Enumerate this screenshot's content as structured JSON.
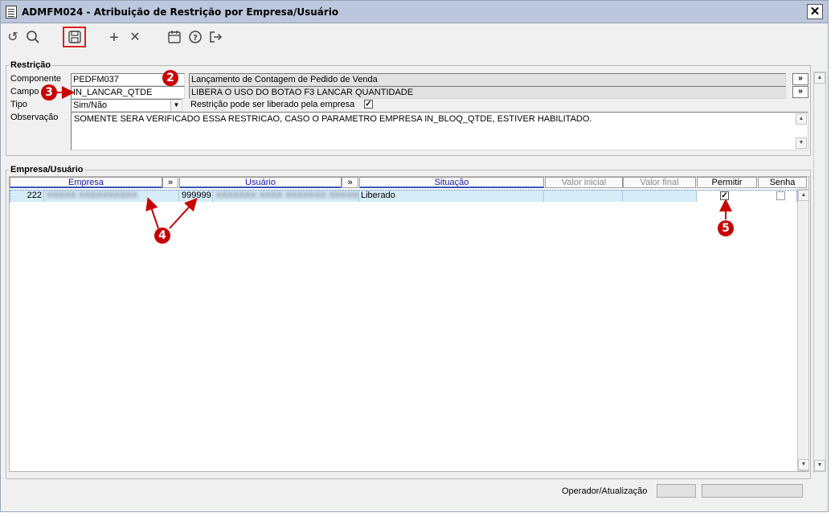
{
  "window": {
    "title": "ADMFM024 - Atribuição de Restrição por Empresa/Usuário",
    "close_glyph": "✕"
  },
  "toolbar": {
    "undo_glyph": "↺",
    "search_glyph": "○",
    "save_glyph": "▣",
    "add_glyph": "+",
    "delete_glyph": "✕",
    "calendar_glyph": "▦",
    "help_glyph": "?",
    "exit_glyph": "⇥"
  },
  "restricao": {
    "group_label": "Restrição",
    "componente_label": "Componente",
    "componente_value": "PEDFM037",
    "componente_desc": "Lançamento de Contagem de Pedido de Venda",
    "campo_label": "Campo",
    "campo_value": "IN_LANCAR_QTDE",
    "campo_desc": "LIBERA O USO DO BOTAO F3 LANCAR QUANTIDADE",
    "tipo_label": "Tipo",
    "tipo_value": "Sim/Não",
    "liberado_label": "Restrição pode ser liberado pela empresa",
    "liberado_checked": "✓",
    "observacao_label": "Observação",
    "observacao_value": "SOMENTE SERA VERIFICADO ESSA RESTRICAO, CASO O PARAMETRO EMPRESA IN_BLOQ_QTDE, ESTIVER HABILITADO.",
    "more_glyph": "»"
  },
  "empresa_usuario": {
    "group_label": "Empresa/Usuário",
    "columns": {
      "empresa": "Empresa",
      "usuario": "Usuário",
      "situacao": "Situação",
      "valor_inicial": "Valor inicial",
      "valor_final": "Valor final",
      "permitir": "Permitir",
      "senha": "Senha",
      "more_glyph": "»"
    },
    "rows": [
      {
        "empresa_code": "222",
        "empresa_name": "XXXXX XXXXXXXXXX",
        "usuario_code": "999999",
        "usuario_name": "XXXXXXX XXXX XXXXXXX XXXXXXX",
        "situacao": "Liberado",
        "valor_inicial": "",
        "valor_final": "",
        "permitir": "✓",
        "senha": ""
      }
    ]
  },
  "footer": {
    "operador_label": "Operador/Atualização"
  },
  "callouts": {
    "b2": "2",
    "b3": "3",
    "b4": "4",
    "b5": "5"
  },
  "scroll": {
    "up": "▲",
    "down": "▼",
    "dd": "▼"
  }
}
